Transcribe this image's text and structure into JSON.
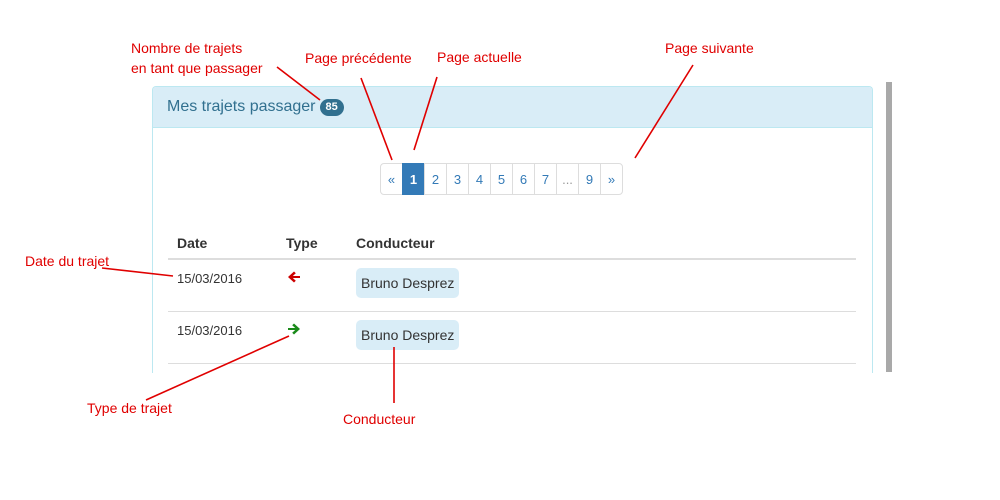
{
  "panel": {
    "title": "Mes trajets passager",
    "count": "85"
  },
  "pagination": {
    "prev": "«",
    "pages": [
      "1",
      "2",
      "3",
      "4",
      "5",
      "6",
      "7",
      "...",
      "9"
    ],
    "active": "1",
    "next": "»"
  },
  "table": {
    "headers": {
      "date": "Date",
      "type": "Type",
      "driver": "Conducteur"
    },
    "rows": [
      {
        "date": "15/03/2016",
        "type": "arrow-left-icon",
        "driver": "Bruno Desprez"
      },
      {
        "date": "15/03/2016",
        "type": "arrow-right-icon",
        "driver": "Bruno Desprez"
      }
    ]
  },
  "annotations": {
    "count_line1": "Nombre de trajets",
    "count_line2": "en tant que passager",
    "prev_page": "Page précédente",
    "current_page": "Page actuelle",
    "next_page": "Page suivante",
    "date": "Date du trajet",
    "type": "Type de trajet",
    "driver": "Conducteur"
  },
  "colors": {
    "annotation": "#e00000",
    "arrow_left": "#cc0000",
    "arrow_right": "#1a8a1a",
    "active_page": "#337ab7",
    "heading_bg": "#d9edf7"
  }
}
